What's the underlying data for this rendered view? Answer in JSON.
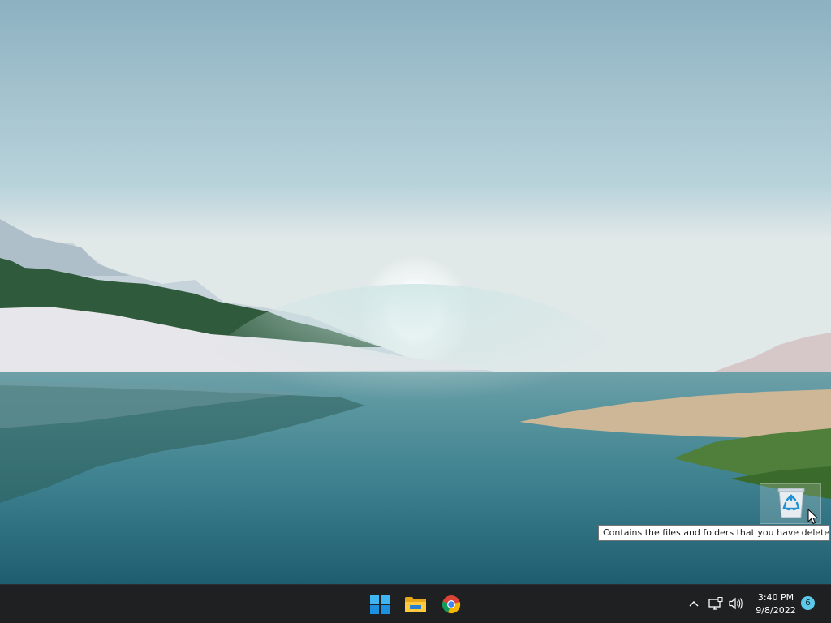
{
  "desktop": {
    "wallpaper": "Windows 11 lake landscape",
    "recycle_bin": {
      "icon": "recycle-bin-icon",
      "tooltip": "Contains the files and folders that you have deleted."
    }
  },
  "taskbar": {
    "pinned": [
      {
        "name": "Start",
        "icon": "windows-logo-icon"
      },
      {
        "name": "File Explorer",
        "icon": "folder-icon"
      },
      {
        "name": "Google Chrome",
        "icon": "chrome-icon"
      }
    ],
    "tray": {
      "chevron_icon": "chevron-up-icon",
      "network_icon": "network-icon",
      "volume_icon": "volume-icon",
      "time": "3:40 PM",
      "date": "9/8/2022",
      "notification_count": "6"
    }
  },
  "colors": {
    "taskbar_bg": "#1f2022",
    "accent": "#5dc8ea"
  }
}
